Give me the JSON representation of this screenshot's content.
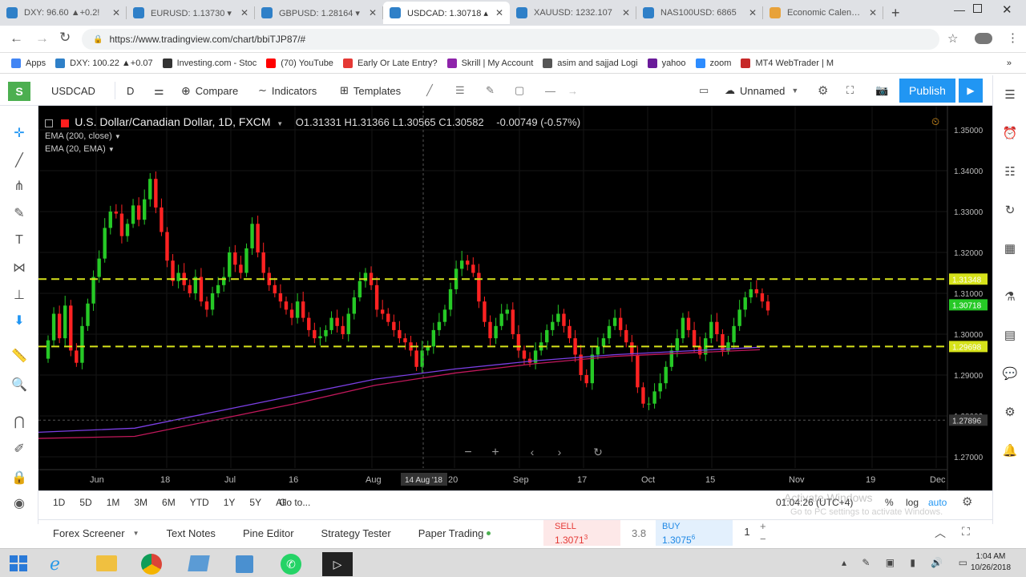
{
  "browser": {
    "tabs": [
      {
        "label": "DXY: 96.60 ▲+0.2!",
        "active": false
      },
      {
        "label": "EURUSD: 1.13730 ▾",
        "active": false
      },
      {
        "label": "GBPUSD: 1.28164 ▾",
        "active": false
      },
      {
        "label": "USDCAD: 1.30718 ▴",
        "active": true
      },
      {
        "label": "XAUUSD: 1232.107",
        "active": false
      },
      {
        "label": "NAS100USD: 6865",
        "active": false
      },
      {
        "label": "Economic Calendar",
        "active": false
      }
    ],
    "url": "https://www.tradingview.com/chart/bbiTJP87/#",
    "bookmarks": [
      {
        "label": "Apps",
        "color": "#4285f4"
      },
      {
        "label": "DXY: 100.22 ▲+0.07",
        "color": "#2f80c8"
      },
      {
        "label": "Investing.com - Stoc",
        "color": "#333333"
      },
      {
        "label": "(70) YouTube",
        "color": "#ff0000"
      },
      {
        "label": "Early Or Late Entry?",
        "color": "#e53935"
      },
      {
        "label": "Skrill | My Account",
        "color": "#8e24aa"
      },
      {
        "label": "asim and sajjad Logi",
        "color": "#555555"
      },
      {
        "label": "yahoo",
        "color": "#6a1b9a"
      },
      {
        "label": "zoom",
        "color": "#2d8cff"
      },
      {
        "label": "MT4 WebTrader | M",
        "color": "#c62828"
      }
    ]
  },
  "toolbar": {
    "symbol": "USDCAD",
    "interval": "D",
    "compare": "Compare",
    "indicators": "Indicators",
    "templates": "Templates",
    "layout_name": "Unnamed",
    "publish": "Publish"
  },
  "chart": {
    "title": "U.S. Dollar/Canadian Dollar, 1D, FXCM",
    "ohlc": "O1.31331  H1.31366  L1.30565  C1.30582",
    "change": "-0.00749 (-0.57%)",
    "indicators": [
      "EMA (200, close)",
      "EMA (20, EMA)"
    ],
    "price_ticks": [
      "1.35000",
      "1.34000",
      "1.33000",
      "1.32000",
      "1.31000",
      "1.30000",
      "1.29000",
      "1.28000",
      "1.27000"
    ],
    "time_ticks": [
      "Jun",
      "18",
      "Jul",
      "16",
      "Aug",
      "20",
      "Sep",
      "17",
      "Oct",
      "15",
      "Nov",
      "19",
      "Dec"
    ],
    "crosshair_date": "14 Aug '18",
    "crosshair_price": "1.27896",
    "level_labels": [
      "1.31348",
      "1.30718",
      "1.29698"
    ],
    "colors": {
      "up": "#26c926",
      "down": "#ff2222",
      "level": "#d6e21a",
      "ema200": "#7b3fe4",
      "ema20": "#c2185b"
    }
  },
  "timebar": {
    "ranges": [
      "1D",
      "5D",
      "1M",
      "3M",
      "6M",
      "YTD",
      "1Y",
      "5Y",
      "All"
    ],
    "goto": "Go to...",
    "clock": "01:04:26 (UTC+4)",
    "pct": "%",
    "log": "log",
    "auto": "auto",
    "watermark1": "Activate Windows",
    "watermark2": "Go to PC settings to activate Windows."
  },
  "panels": {
    "items": [
      "Forex Screener",
      "Text Notes",
      "Pine Editor",
      "Strategy Tester",
      "Paper Trading"
    ],
    "sell_label": "SELL",
    "sell_price": "1.3071",
    "sell_sup": "3",
    "spread": "3.8",
    "buy_label": "BUY",
    "buy_price": "1.3075",
    "buy_sup": "6",
    "qty": "1"
  },
  "taskbar": {
    "time": "1:04 AM",
    "date": "10/26/2018"
  }
}
